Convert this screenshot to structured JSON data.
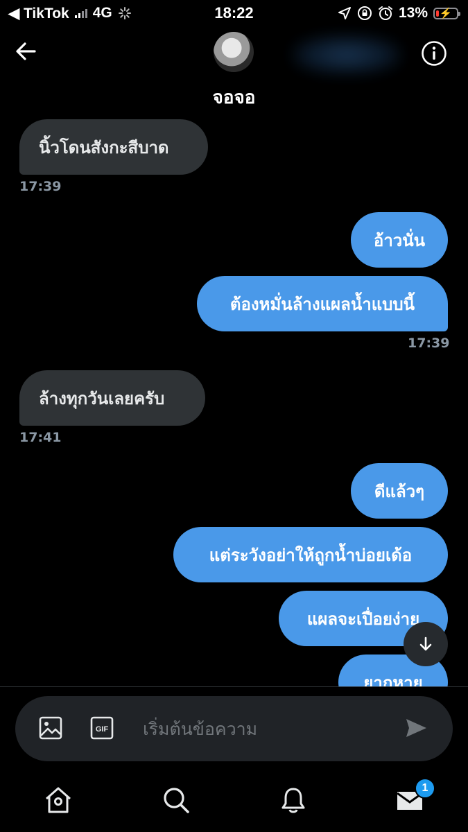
{
  "status_bar": {
    "back_app": "◀ TikTok",
    "network": "4G",
    "time": "18:22",
    "battery_percent": "13%",
    "battery_level": 0.13
  },
  "header": {
    "contact_name": "จอจอ"
  },
  "conversation": {
    "messages": [
      {
        "direction": "in",
        "text": "นิ้วโดนสังกะสีบาด",
        "time": "17:39"
      },
      {
        "direction": "out",
        "text": "อ้าวนั่น"
      },
      {
        "direction": "out",
        "text": "ต้องหมั่นล้างแผลน้ำแบบนี้",
        "time": "17:39"
      },
      {
        "direction": "in",
        "text": "ล้างทุกวันเลยครับ",
        "time": "17:41"
      },
      {
        "direction": "out",
        "text": "ดีแล้วๆ"
      },
      {
        "direction": "out",
        "text": "แต่ระวังอย่าให้ถูกน้ำบ่อยเด้อ"
      },
      {
        "direction": "out",
        "text": "แผลจะเปื่อยง่าย"
      },
      {
        "direction": "out",
        "text": "ยากหาย"
      }
    ]
  },
  "composer": {
    "placeholder": "เริ่มต้นข้อความ",
    "gif_label": "GIF"
  },
  "bottom_nav": {
    "messages_badge": "1"
  },
  "colors": {
    "background": "#000000",
    "incoming_bubble": "#2f3336",
    "outgoing_bubble": "#4a99e9",
    "timestamp": "#8b98a5",
    "badge": "#1d9bf0",
    "battery_low": "#ff3b30"
  },
  "icons": [
    "back-arrow-icon",
    "info-icon",
    "image-icon",
    "gif-icon",
    "send-icon",
    "home-icon",
    "search-icon",
    "notifications-bell-icon",
    "messages-envelope-icon",
    "arrow-down-icon",
    "location-arrow-icon",
    "orientation-lock-icon",
    "alarm-icon",
    "battery-icon"
  ]
}
